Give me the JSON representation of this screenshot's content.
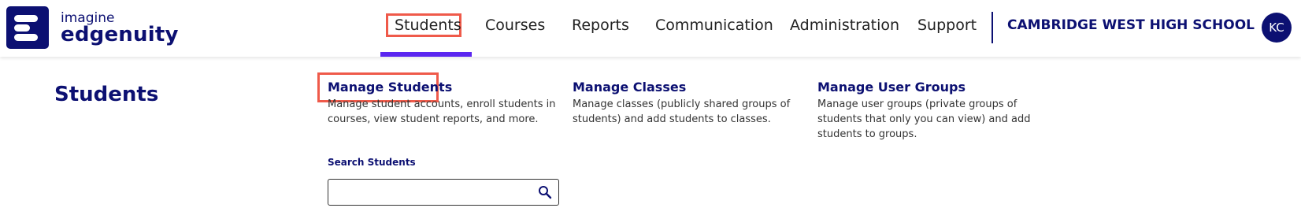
{
  "brand": {
    "line1": "imagine",
    "line2": "edgenuity"
  },
  "nav": {
    "items": [
      "Students",
      "Courses",
      "Reports",
      "Communication",
      "Administration",
      "Support"
    ],
    "active": "Students"
  },
  "school_name": "CAMBRIDGE WEST HIGH SCHOOL",
  "avatar_initials": "KC",
  "page_heading": "Students",
  "cards": [
    {
      "title": "Manage Students",
      "description": "Manage student accounts, enroll students in courses, view student reports, and more."
    },
    {
      "title": "Manage Classes",
      "description": "Manage classes (publicly shared groups of students) and add students to classes."
    },
    {
      "title": "Manage User Groups",
      "description": "Manage user groups (private groups of students that only you can view) and add students to groups."
    }
  ],
  "search": {
    "label": "Search Students",
    "value": "",
    "placeholder": ""
  },
  "colors": {
    "brand_navy": "#0c1072",
    "active_underline": "#5b26f0",
    "highlight_box": "#ef5a4a"
  }
}
